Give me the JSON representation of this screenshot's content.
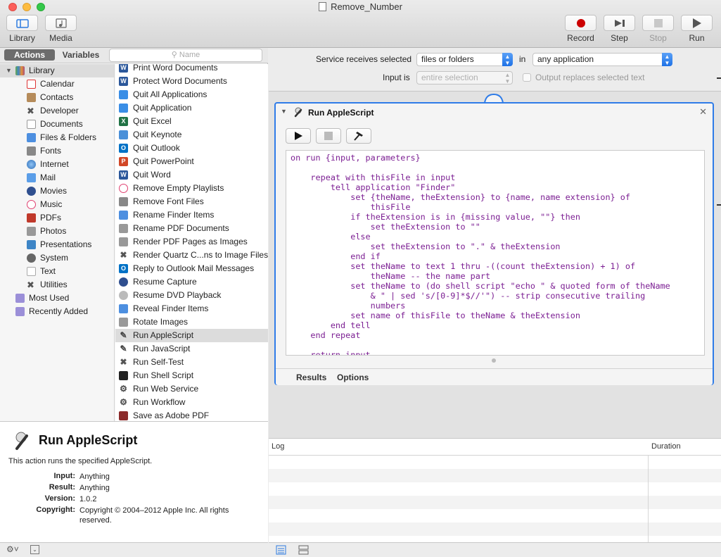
{
  "window": {
    "title": "Remove_Number"
  },
  "toolbar": {
    "library_label": "Library",
    "media_label": "Media",
    "record_label": "Record",
    "step_label": "Step",
    "stop_label": "Stop",
    "run_label": "Run"
  },
  "left_tabs": {
    "actions": "Actions",
    "variables": "Variables",
    "search_placeholder": "Name"
  },
  "library": {
    "root": "Library",
    "items": [
      "Calendar",
      "Contacts",
      "Developer",
      "Documents",
      "Files & Folders",
      "Fonts",
      "Internet",
      "Mail",
      "Movies",
      "Music",
      "PDFs",
      "Photos",
      "Presentations",
      "System",
      "Text",
      "Utilities"
    ],
    "smart": [
      "Most Used",
      "Recently Added"
    ]
  },
  "actions_list": [
    "Print Word Documents",
    "Protect Word Documents",
    "Quit All Applications",
    "Quit Application",
    "Quit Excel",
    "Quit Keynote",
    "Quit Outlook",
    "Quit PowerPoint",
    "Quit Word",
    "Remove Empty Playlists",
    "Remove Font Files",
    "Rename Finder Items",
    "Rename PDF Documents",
    "Render PDF Pages as Images",
    "Render Quartz C...ns to Image Files",
    "Reply to Outlook Mail Messages",
    "Resume Capture",
    "Resume DVD Playback",
    "Reveal Finder Items",
    "Rotate Images",
    "Run AppleScript",
    "Run JavaScript",
    "Run Self-Test",
    "Run Shell Script",
    "Run Web Service",
    "Run Workflow",
    "Save as Adobe PDF"
  ],
  "description": {
    "title": "Run AppleScript",
    "text": "This action runs the specified AppleScript.",
    "input_key": "Input:",
    "input_val": "Anything",
    "result_key": "Result:",
    "result_val": "Anything",
    "version_key": "Version:",
    "version_val": "1.0.2",
    "copyright_key": "Copyright:",
    "copyright_val": "Copyright © 2004–2012 Apple Inc.  All rights reserved."
  },
  "service": {
    "receives_label": "Service receives selected",
    "receives_value": "files or folders",
    "in_label": "in",
    "app_value": "any application",
    "input_is_label": "Input is",
    "input_is_value": "entire selection",
    "output_replaces": "Output replaces selected text"
  },
  "action_card": {
    "title": "Run AppleScript",
    "script": "on run {input, parameters}\n\n    repeat with thisFile in input\n        tell application \"Finder\"\n            set {theName, theExtension} to {name, name extension} of\n                thisFile\n            if theExtension is in {missing value, \"\"} then\n                set theExtension to \"\"\n            else\n                set theExtension to \".\" & theExtension\n            end if\n            set theName to text 1 thru -((count theExtension) + 1) of\n                theName -- the name part\n            set theName to (do shell script \"echo \" & quoted form of theName\n                & \" | sed 's/[0-9]*$//'\") -- strip consecutive trailing\n                numbers\n            set name of thisFile to theName & theExtension\n        end tell\n    end repeat\n\n    return input",
    "tab_results": "Results",
    "tab_options": "Options"
  },
  "log": {
    "col_log": "Log",
    "col_duration": "Duration"
  },
  "colors": {
    "accent": "#2f7ce8",
    "script_text": "#7c1f93",
    "record_red": "#cc0000"
  }
}
